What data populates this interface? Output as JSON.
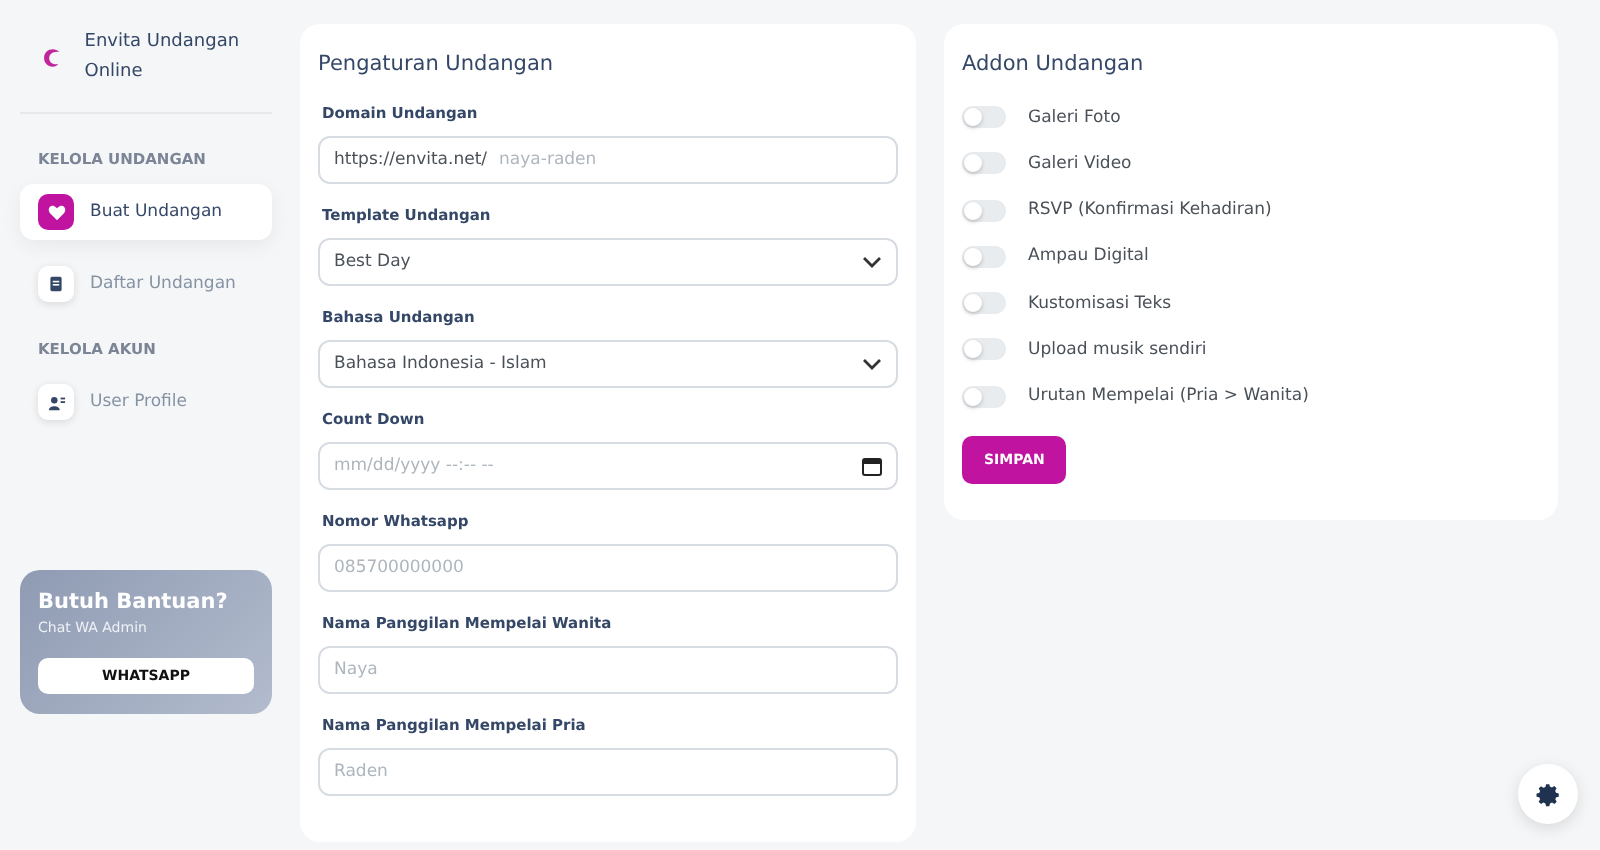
{
  "brand": {
    "name": "Envita Undangan Online"
  },
  "sidebar": {
    "sections": [
      {
        "heading": "KELOLA UNDANGAN",
        "items": [
          {
            "label": "Buat Undangan",
            "selected": true
          },
          {
            "label": "Daftar Undangan",
            "selected": false
          }
        ]
      },
      {
        "heading": "KELOLA AKUN",
        "items": [
          {
            "label": "User Profile",
            "selected": false
          }
        ]
      }
    ]
  },
  "help_card": {
    "title": "Butuh Bantuan?",
    "subtitle": "Chat WA Admin",
    "button": "WHATSAPP"
  },
  "settings_form": {
    "title": "Pengaturan Undangan",
    "fields": [
      {
        "kind": "prefix",
        "label": "Domain Undangan",
        "prefix": "https://envita.net/",
        "placeholder": "naya-raden"
      },
      {
        "kind": "select",
        "label": "Template Undangan",
        "value": "Best Day"
      },
      {
        "kind": "select",
        "label": "Bahasa Undangan",
        "value": "Bahasa Indonesia - Islam"
      },
      {
        "kind": "datetime",
        "label": "Count Down",
        "placeholder": "mm/dd/yyyy --:-- --"
      },
      {
        "kind": "text",
        "label": "Nomor Whatsapp",
        "placeholder": "085700000000"
      },
      {
        "kind": "text",
        "label": "Nama Panggilan Mempelai Wanita",
        "placeholder": "Naya"
      },
      {
        "kind": "text",
        "label": "Nama Panggilan Mempelai Pria",
        "placeholder": "Raden"
      }
    ]
  },
  "addon_form": {
    "title": "Addon Undangan",
    "toggles": [
      {
        "label": "Galeri Foto",
        "on": false
      },
      {
        "label": "Galeri Video",
        "on": false
      },
      {
        "label": "RSVP (Konfirmasi Kehadiran)",
        "on": false
      },
      {
        "label": "Ampau Digital",
        "on": false
      },
      {
        "label": "Kustomisasi Teks",
        "on": false
      },
      {
        "label": "Upload musik sendiri",
        "on": false
      },
      {
        "label": "Urutan Mempelai (Pria > Wanita)",
        "on": false
      }
    ],
    "button": "SIMPAN"
  }
}
